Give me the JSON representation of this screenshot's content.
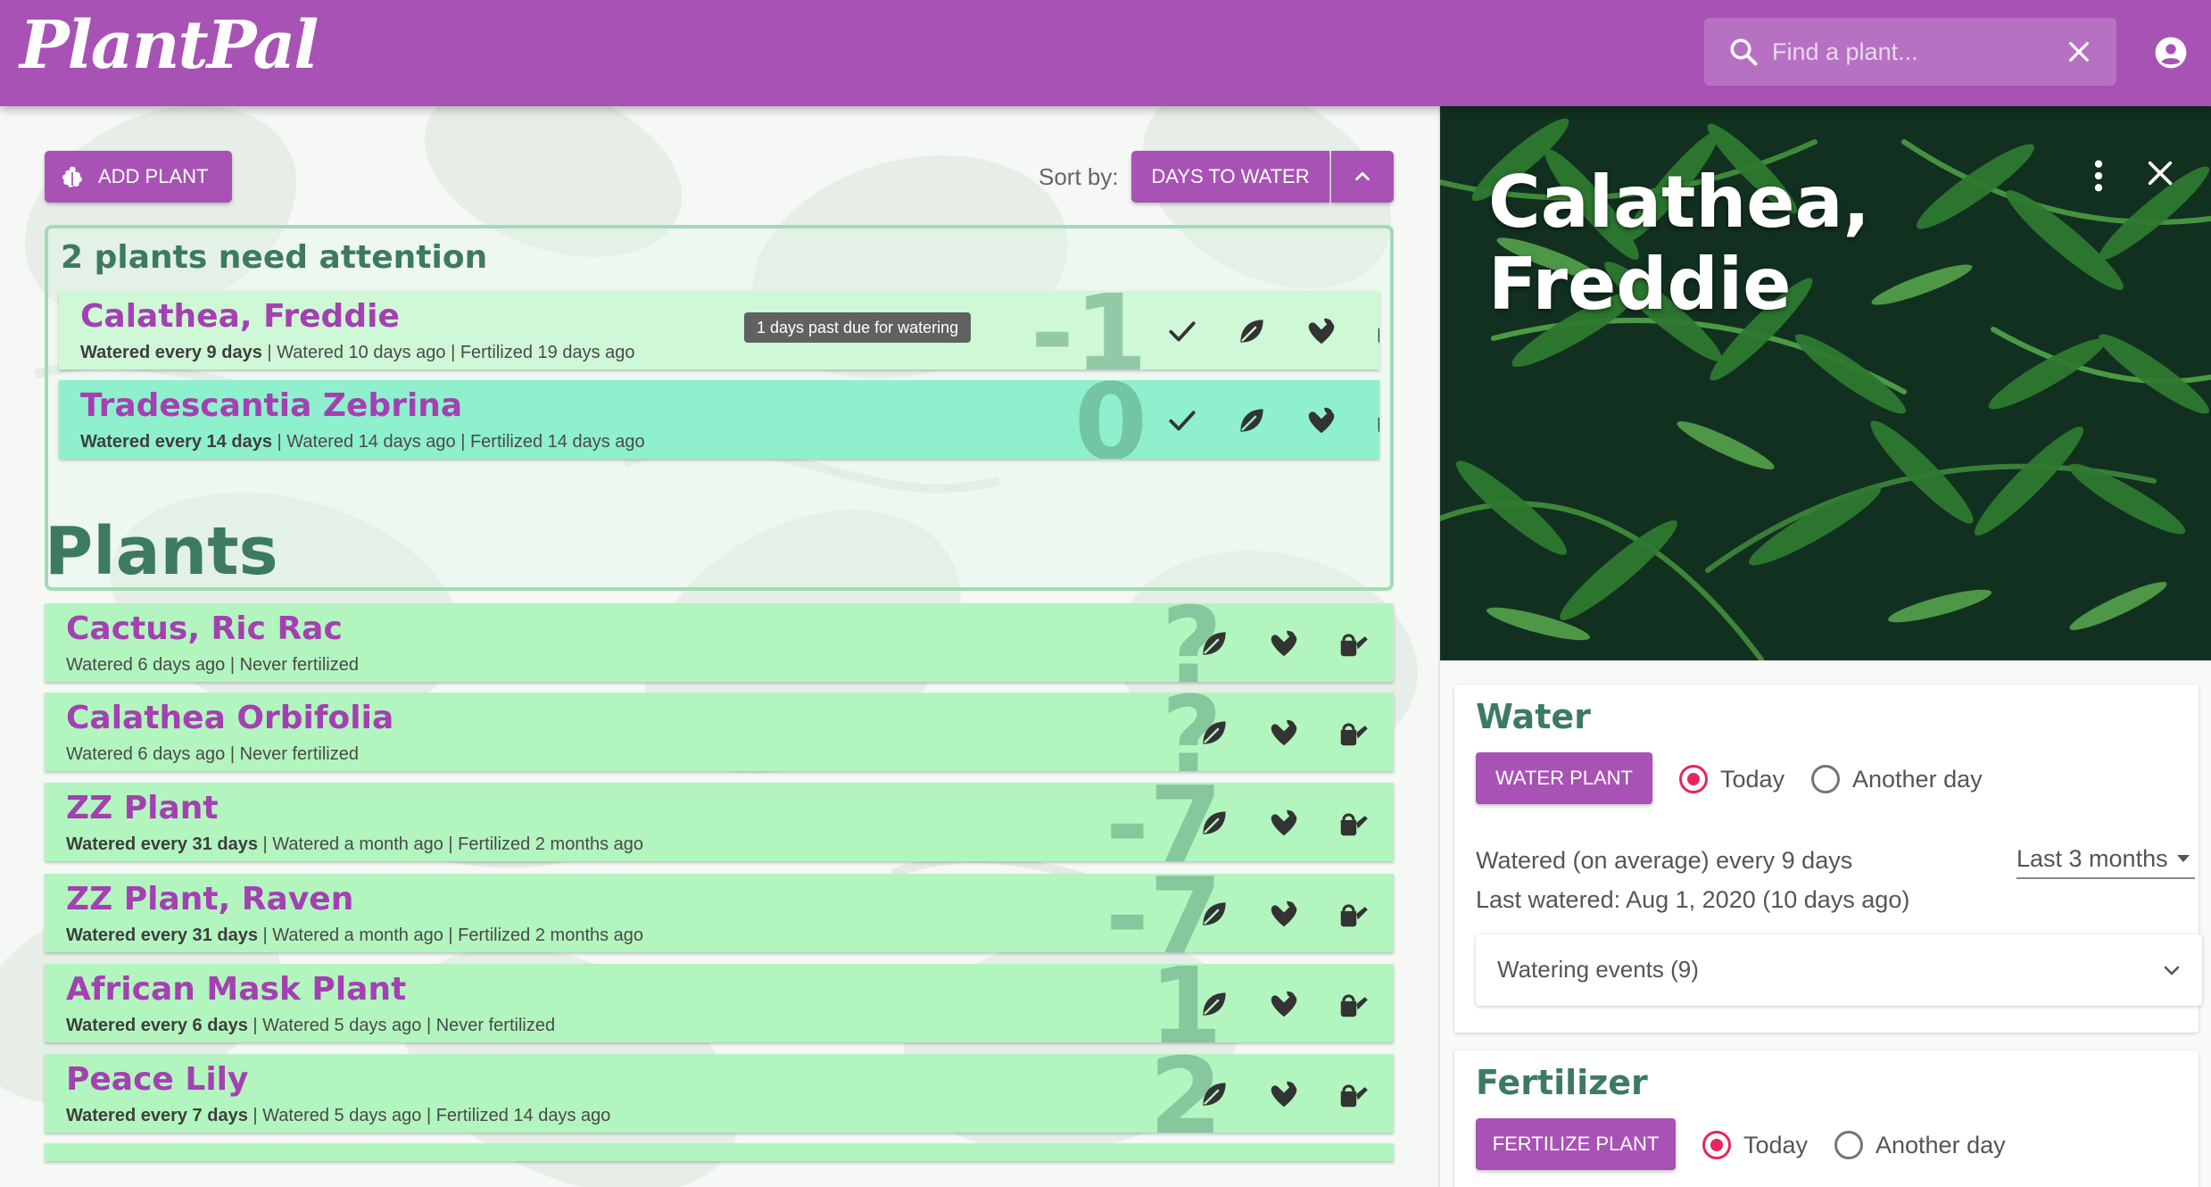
{
  "app": {
    "logo": "PlantPal",
    "search_placeholder": "Find a plant...",
    "brand_color": "#a852b5"
  },
  "toolbar": {
    "add_label": "ADD PLANT",
    "sort_label": "Sort by:",
    "sort_value": "DAYS TO WATER",
    "sort_direction_icon": "chevron-up-icon"
  },
  "attention": {
    "title": "2 plants need attention",
    "tooltip": "1 days past due for watering",
    "items": [
      {
        "name": "Calathea, Freddie",
        "freq": "Watered every 9 days",
        "watered": "Watered 10 days ago",
        "fertilized": "Fertilized 19 days ago",
        "days": "-1"
      },
      {
        "name": "Tradescantia Zebrina",
        "freq": "Watered every 14 days",
        "watered": "Watered 14 days ago",
        "fertilized": "Fertilized 14 days ago",
        "days": "0"
      }
    ]
  },
  "plants": {
    "title": "Plants",
    "items": [
      {
        "name": "Cactus, Ric Rac",
        "freq": "",
        "watered": "Watered 6 days ago",
        "fertilized": "Never fertilized",
        "days": "?"
      },
      {
        "name": "Calathea Orbifolia",
        "freq": "",
        "watered": "Watered 6 days ago",
        "fertilized": "Never fertilized",
        "days": "?"
      },
      {
        "name": "ZZ Plant",
        "freq": "Watered every 31 days",
        "watered": "Watered a month ago",
        "fertilized": "Fertilized 2 months ago",
        "days": "-7"
      },
      {
        "name": "ZZ Plant, Raven",
        "freq": "Watered every 31 days",
        "watered": "Watered a month ago",
        "fertilized": "Fertilized 2 months ago",
        "days": "-7"
      },
      {
        "name": "African Mask Plant",
        "freq": "Watered every 6 days",
        "watered": "Watered 5 days ago",
        "fertilized": "Never fertilized",
        "days": "1"
      },
      {
        "name": "Peace Lily",
        "freq": "Watered every 7 days",
        "watered": "Watered 5 days ago",
        "fertilized": "Fertilized 14 days ago",
        "days": "2"
      }
    ]
  },
  "detail": {
    "title": "Calathea, Freddie",
    "water": {
      "heading": "Water",
      "button": "WATER PLANT",
      "today": "Today",
      "another": "Another day",
      "selected": "Today",
      "average": "Watered (on average) every 9 days",
      "last": "Last watered: Aug 1, 2020 (10 days ago)",
      "range": "Last 3 months",
      "events": "Watering events (9)"
    },
    "fertilizer": {
      "heading": "Fertilizer",
      "button": "FERTILIZE PLANT",
      "today": "Today",
      "another": "Another day",
      "selected": "Today"
    }
  }
}
